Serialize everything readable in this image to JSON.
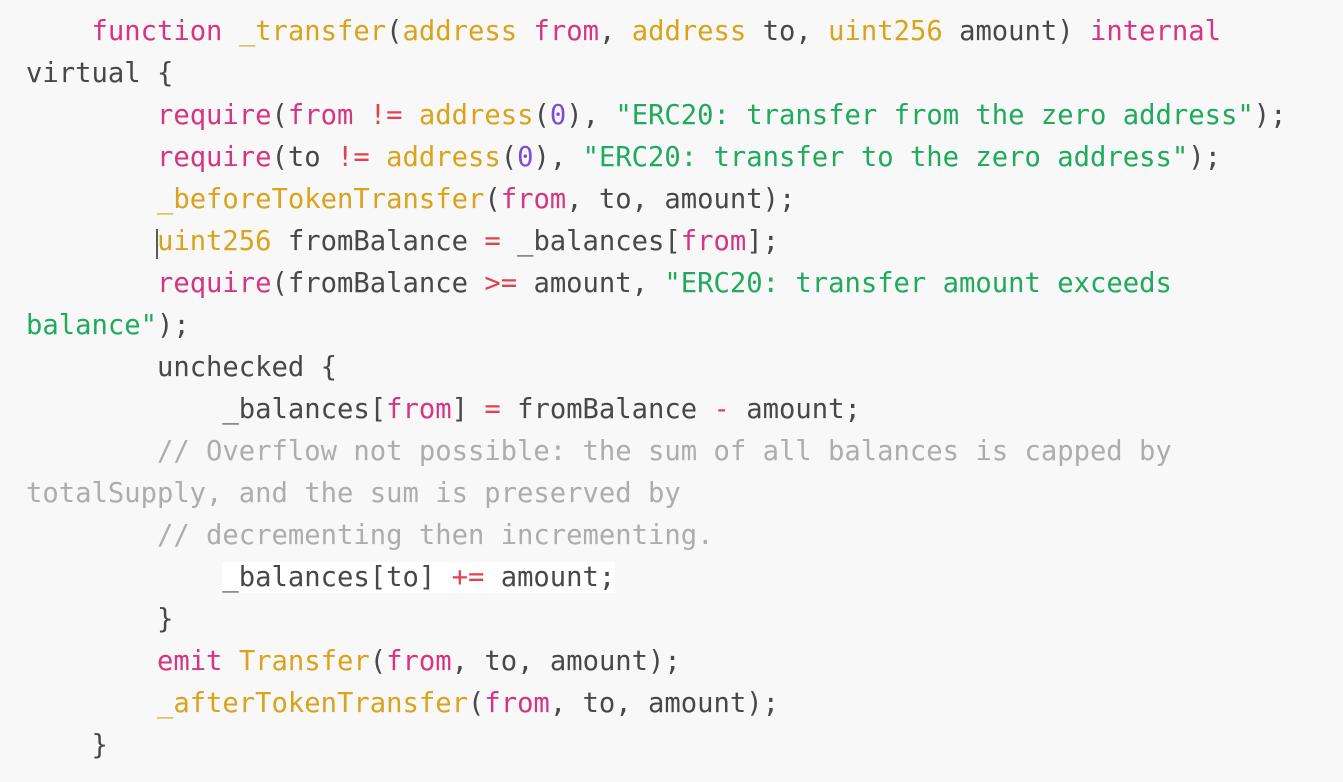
{
  "editor": {
    "background_color": "#f8f8f8",
    "language": "solidity",
    "font_size_px": 27,
    "line_height_px": 42,
    "wrap_enabled": true,
    "caret_visible": true,
    "caret_line_index": 4,
    "caret_column": 8
  },
  "theme": {
    "keyword_color": "#d6357f",
    "type_color": "#d9a41b",
    "string_color": "#1faa5d",
    "number_color": "#7b4ddb",
    "operator_color": "#e0404f",
    "plain_color": "#484848",
    "comment_color": "#adadad",
    "background_color": "#f8f8f8",
    "highlight_color": "#ffffff",
    "caret_color": "#5a5a5a"
  },
  "code": {
    "full_text": "    function _transfer(address from, address to, uint256 amount) internal virtual {\n        require(from != address(0), \"ERC20: transfer from the zero address\");\n        require(to != address(0), \"ERC20: transfer to the zero address\");\n        _beforeTokenTransfer(from, to, amount);\n        uint256 fromBalance = _balances[from];\n        require(fromBalance >= amount, \"ERC20: transfer amount exceeds balance\");\n        unchecked {\n            _balances[from] = fromBalance - amount;\n            // Overflow not possible: the sum of all balances is capped by totalSupply, and the sum is preserved by\n            // decrementing then incrementing.\n            _balances[to] += amount;\n        }\n        emit Transfer(from, to, amount);\n        _afterTokenTransfer(from, to, amount);\n    }",
    "lines": [
      {
        "index": 0,
        "indent": "    ",
        "tokens": [
          {
            "t": "function",
            "k": "kw"
          },
          {
            "t": " ",
            "k": "txt"
          },
          {
            "t": "_transfer",
            "k": "type"
          },
          {
            "t": "(",
            "k": "txt"
          },
          {
            "t": "address",
            "k": "type"
          },
          {
            "t": " ",
            "k": "txt"
          },
          {
            "t": "from",
            "k": "kw"
          },
          {
            "t": ", ",
            "k": "txt"
          },
          {
            "t": "address",
            "k": "type"
          },
          {
            "t": " to, ",
            "k": "txt"
          },
          {
            "t": "uint256",
            "k": "type"
          },
          {
            "t": " amount) ",
            "k": "txt"
          },
          {
            "t": "internal",
            "k": "kw"
          },
          {
            "t": " virtual {",
            "k": "txt"
          }
        ]
      },
      {
        "index": 1,
        "indent": "        ",
        "tokens": [
          {
            "t": "require",
            "k": "kw"
          },
          {
            "t": "(",
            "k": "txt"
          },
          {
            "t": "from",
            "k": "kw"
          },
          {
            "t": " ",
            "k": "txt"
          },
          {
            "t": "!=",
            "k": "op"
          },
          {
            "t": " ",
            "k": "txt"
          },
          {
            "t": "address",
            "k": "type"
          },
          {
            "t": "(",
            "k": "txt"
          },
          {
            "t": "0",
            "k": "num"
          },
          {
            "t": "), ",
            "k": "txt"
          },
          {
            "t": "\"ERC20: transfer from the zero address\"",
            "k": "str"
          },
          {
            "t": ");",
            "k": "txt"
          }
        ]
      },
      {
        "index": 2,
        "indent": "        ",
        "tokens": [
          {
            "t": "require",
            "k": "kw"
          },
          {
            "t": "(to ",
            "k": "txt"
          },
          {
            "t": "!=",
            "k": "op"
          },
          {
            "t": " ",
            "k": "txt"
          },
          {
            "t": "address",
            "k": "type"
          },
          {
            "t": "(",
            "k": "txt"
          },
          {
            "t": "0",
            "k": "num"
          },
          {
            "t": "), ",
            "k": "txt"
          },
          {
            "t": "\"ERC20: transfer to the zero address\"",
            "k": "str"
          },
          {
            "t": ");",
            "k": "txt"
          }
        ]
      },
      {
        "index": 3,
        "indent": "        ",
        "tokens": [
          {
            "t": "_beforeTokenTransfer",
            "k": "type"
          },
          {
            "t": "(",
            "k": "txt"
          },
          {
            "t": "from",
            "k": "kw"
          },
          {
            "t": ", to, amount);",
            "k": "txt"
          }
        ]
      },
      {
        "index": 4,
        "indent": "        ",
        "tokens": [
          {
            "t": "uint256",
            "k": "type"
          },
          {
            "t": " fromBalance ",
            "k": "txt"
          },
          {
            "t": "=",
            "k": "op"
          },
          {
            "t": " _balances[",
            "k": "txt"
          },
          {
            "t": "from",
            "k": "kw"
          },
          {
            "t": "];",
            "k": "txt"
          }
        ]
      },
      {
        "index": 5,
        "indent": "        ",
        "tokens": [
          {
            "t": "require",
            "k": "kw"
          },
          {
            "t": "(fromBalance ",
            "k": "txt"
          },
          {
            "t": ">=",
            "k": "op"
          },
          {
            "t": " amount, ",
            "k": "txt"
          },
          {
            "t": "\"ERC20: transfer amount exceeds balance\"",
            "k": "str"
          },
          {
            "t": ");",
            "k": "txt"
          }
        ]
      },
      {
        "index": 6,
        "indent": "        ",
        "tokens": [
          {
            "t": "unchecked {",
            "k": "txt"
          }
        ]
      },
      {
        "index": 7,
        "indent": "            ",
        "tokens": [
          {
            "t": "_balances[",
            "k": "txt"
          },
          {
            "t": "from",
            "k": "kw"
          },
          {
            "t": "] ",
            "k": "txt"
          },
          {
            "t": "=",
            "k": "op"
          },
          {
            "t": " fromBalance ",
            "k": "txt"
          },
          {
            "t": "-",
            "k": "op"
          },
          {
            "t": " amount;",
            "k": "txt"
          }
        ]
      },
      {
        "index": 8,
        "indent": "        ",
        "tokens": [
          {
            "t": "// Overflow not possible: the sum of all balances is capped by totalSupply, and the sum is preserved by",
            "k": "com"
          }
        ]
      },
      {
        "index": 9,
        "indent": "        ",
        "tokens": [
          {
            "t": "// decrementing then incrementing.",
            "k": "com"
          }
        ]
      },
      {
        "index": 10,
        "indent": "            ",
        "tokens": [
          {
            "t": "_balances[to] ",
            "k": "txt"
          },
          {
            "t": "+=",
            "k": "op"
          },
          {
            "t": " amount;",
            "k": "txt"
          }
        ]
      },
      {
        "index": 11,
        "indent": "        ",
        "tokens": [
          {
            "t": "}",
            "k": "txt"
          }
        ]
      },
      {
        "index": 12,
        "indent": "        ",
        "tokens": [
          {
            "t": "emit",
            "k": "kw"
          },
          {
            "t": " ",
            "k": "txt"
          },
          {
            "t": "Transfer",
            "k": "type"
          },
          {
            "t": "(",
            "k": "txt"
          },
          {
            "t": "from",
            "k": "kw"
          },
          {
            "t": ", to, amount);",
            "k": "txt"
          }
        ]
      },
      {
        "index": 13,
        "indent": "        ",
        "tokens": [
          {
            "t": "_afterTokenTransfer",
            "k": "type"
          },
          {
            "t": "(",
            "k": "txt"
          },
          {
            "t": "from",
            "k": "kw"
          },
          {
            "t": ", to, amount);",
            "k": "txt"
          }
        ]
      },
      {
        "index": 14,
        "indent": "    ",
        "tokens": [
          {
            "t": "}",
            "k": "txt"
          }
        ]
      }
    ]
  }
}
